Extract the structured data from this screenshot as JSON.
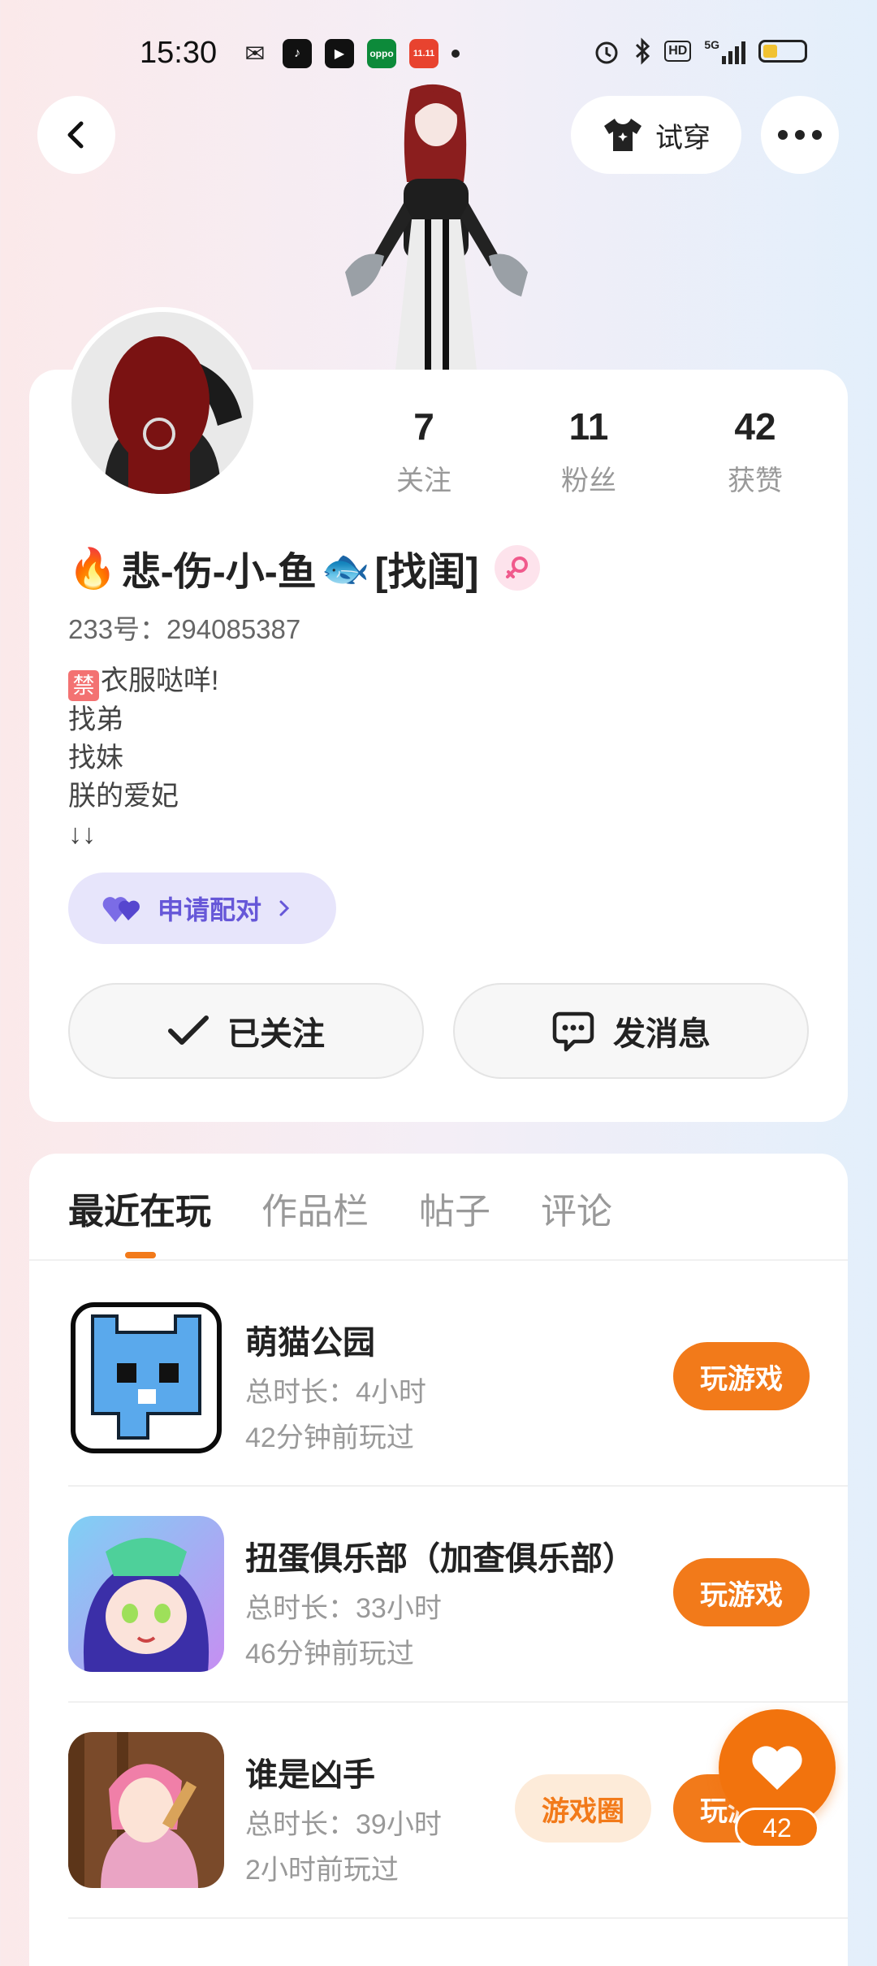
{
  "status_bar": {
    "time": "15:30",
    "apps": [
      {
        "name": "wechat-icon",
        "color": "#222",
        "glyph": "●"
      },
      {
        "name": "tiktok-icon",
        "color": "#111",
        "glyph": "♪"
      },
      {
        "name": "video-icon",
        "color": "#111",
        "glyph": "▶"
      },
      {
        "name": "oppo-icon",
        "color": "#0d8a3a",
        "glyph": "oppo"
      },
      {
        "name": "shop-icon",
        "color": "#e8432f",
        "glyph": "11.11"
      }
    ],
    "network": "5G",
    "hd_label": "HD",
    "battery_level": 0.35
  },
  "header": {
    "tryon_label": "试穿",
    "accent": "#f27a1a"
  },
  "profile": {
    "stats": [
      {
        "value": "7",
        "label": "关注"
      },
      {
        "value": "11",
        "label": "粉丝"
      },
      {
        "value": "42",
        "label": "获赞"
      }
    ],
    "name_prefix_emoji": "🔥",
    "name": "悲-伤-小-鱼",
    "name_fish_emoji": "🐟",
    "name_suffix": "[找闺]",
    "gender_symbol": "⚲",
    "id_text": "233号：294085387",
    "bio_ban": "禁",
    "bio_lines": [
      "衣服哒咩!",
      "找弟",
      "找妹",
      "朕的爱妃",
      "↓↓"
    ],
    "match_label": "申请配对",
    "follow_label": "已关注",
    "message_label": "发消息"
  },
  "tabs": [
    {
      "label": "最近在玩",
      "active": true
    },
    {
      "label": "作品栏",
      "active": false
    },
    {
      "label": "帖子",
      "active": false
    },
    {
      "label": "评论",
      "active": false
    }
  ],
  "games": [
    {
      "title": "萌猫公园",
      "duration": "总时长：4小时",
      "last_played": "42分钟前玩过",
      "play_label": "玩游戏"
    },
    {
      "title": "扭蛋俱乐部（加查俱乐部）",
      "duration": "总时长：33小时",
      "last_played": "46分钟前玩过",
      "play_label": "玩游戏"
    },
    {
      "title": "谁是凶手",
      "duration": "总时长：39小时",
      "last_played": "2小时前玩过",
      "play_label": "玩游戏",
      "circle_label": "游戏圈"
    }
  ],
  "like_fab": {
    "count": "42"
  }
}
